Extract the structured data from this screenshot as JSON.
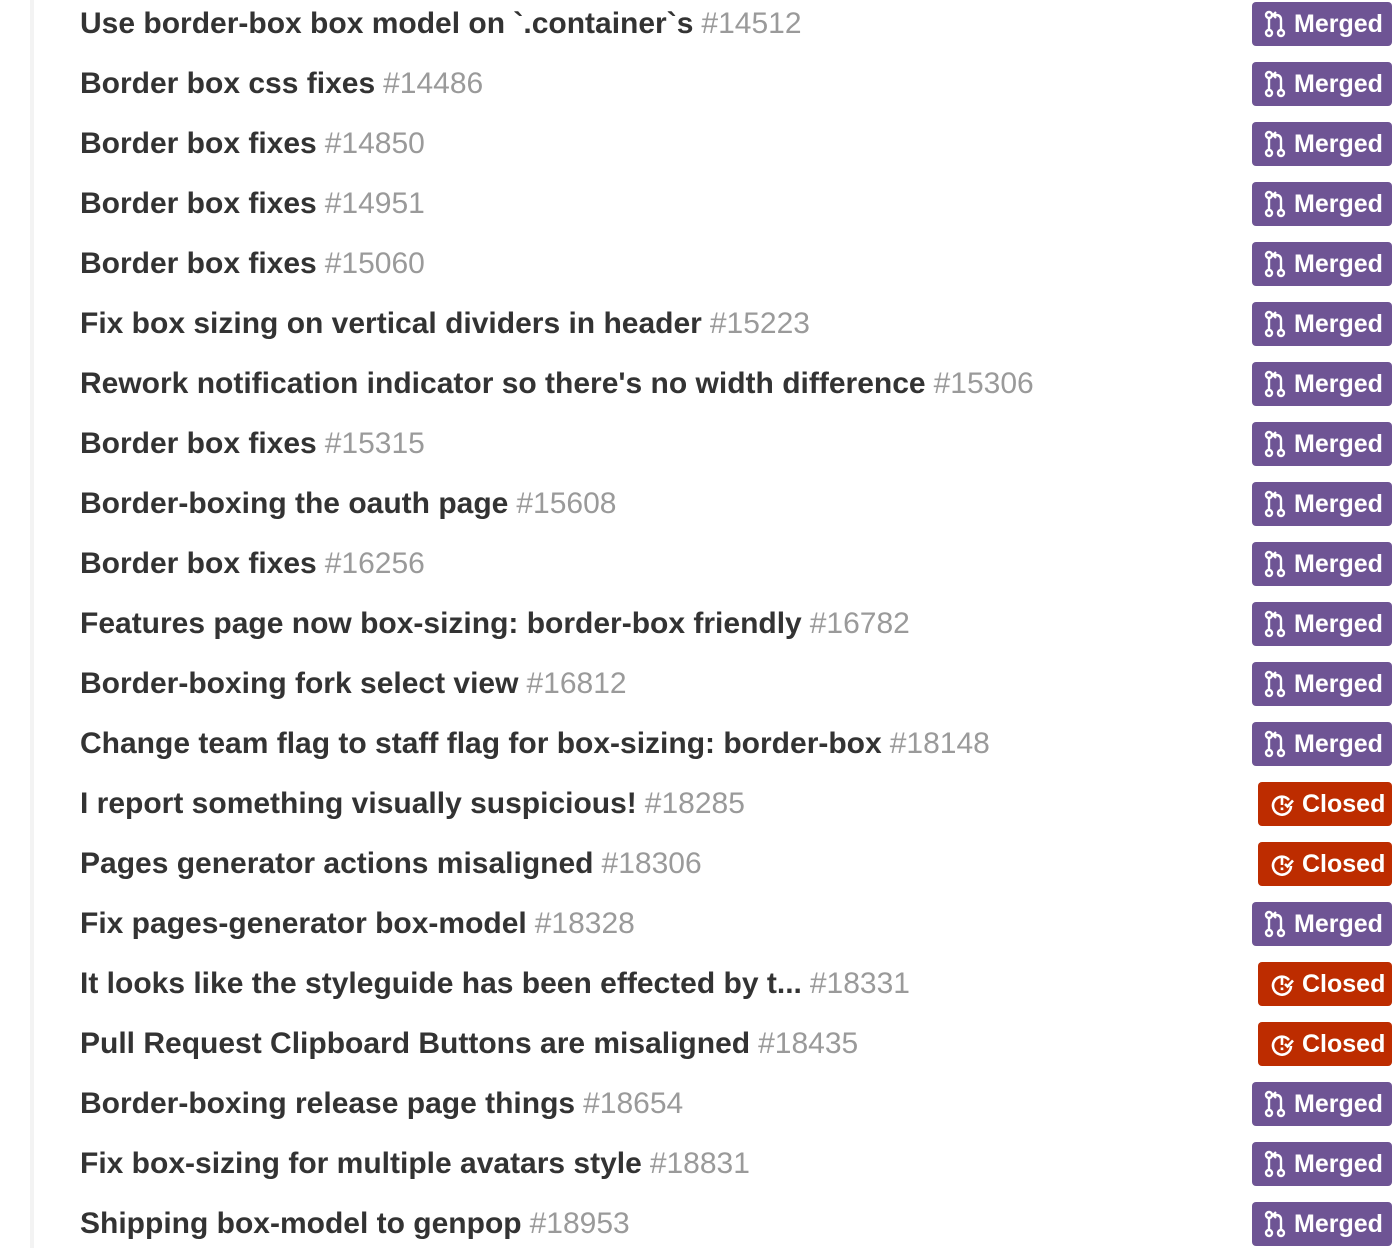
{
  "colors": {
    "merged": "#6e5494",
    "closed": "#bd2c00",
    "title": "#333333",
    "number": "#9a9a9a"
  },
  "items": [
    {
      "title": "Use border-box box model on `.container`s",
      "number": "#14512",
      "state": "Merged",
      "state_icon": "git-merge-icon"
    },
    {
      "title": "Border box css fixes",
      "number": "#14486",
      "state": "Merged",
      "state_icon": "git-merge-icon"
    },
    {
      "title": "Border box fixes",
      "number": "#14850",
      "state": "Merged",
      "state_icon": "git-merge-icon"
    },
    {
      "title": "Border box fixes",
      "number": "#14951",
      "state": "Merged",
      "state_icon": "git-merge-icon"
    },
    {
      "title": "Border box fixes",
      "number": "#15060",
      "state": "Merged",
      "state_icon": "git-merge-icon"
    },
    {
      "title": "Fix box sizing on vertical dividers in header",
      "number": "#15223",
      "state": "Merged",
      "state_icon": "git-merge-icon"
    },
    {
      "title": "Rework notification indicator so there's no width difference",
      "number": "#15306",
      "state": "Merged",
      "state_icon": "git-merge-icon"
    },
    {
      "title": "Border box fixes",
      "number": "#15315",
      "state": "Merged",
      "state_icon": "git-merge-icon"
    },
    {
      "title": "Border-boxing the oauth page",
      "number": "#15608",
      "state": "Merged",
      "state_icon": "git-merge-icon"
    },
    {
      "title": "Border box fixes",
      "number": "#16256",
      "state": "Merged",
      "state_icon": "git-merge-icon"
    },
    {
      "title": "Features page now box-sizing: border-box friendly",
      "number": "#16782",
      "state": "Merged",
      "state_icon": "git-merge-icon"
    },
    {
      "title": "Border-boxing fork select view",
      "number": "#16812",
      "state": "Merged",
      "state_icon": "git-merge-icon"
    },
    {
      "title": "Change team flag to staff flag for box-sizing: border-box",
      "number": "#18148",
      "state": "Merged",
      "state_icon": "git-merge-icon"
    },
    {
      "title": "I report something visually suspicious!",
      "number": "#18285",
      "state": "Closed",
      "state_icon": "issue-closed-icon"
    },
    {
      "title": "Pages generator actions misaligned",
      "number": "#18306",
      "state": "Closed",
      "state_icon": "issue-closed-icon"
    },
    {
      "title": "Fix pages-generator box-model",
      "number": "#18328",
      "state": "Merged",
      "state_icon": "git-merge-icon"
    },
    {
      "title": "It looks like the styleguide has been effected by t...",
      "number": "#18331",
      "state": "Closed",
      "state_icon": "issue-closed-icon"
    },
    {
      "title": "Pull Request Clipboard Buttons are misaligned",
      "number": "#18435",
      "state": "Closed",
      "state_icon": "issue-closed-icon"
    },
    {
      "title": "Border-boxing release page things",
      "number": "#18654",
      "state": "Merged",
      "state_icon": "git-merge-icon"
    },
    {
      "title": "Fix box-sizing for multiple avatars style",
      "number": "#18831",
      "state": "Merged",
      "state_icon": "git-merge-icon"
    },
    {
      "title": "Shipping box-model to genpop",
      "number": "#18953",
      "state": "Merged",
      "state_icon": "git-merge-icon"
    }
  ]
}
